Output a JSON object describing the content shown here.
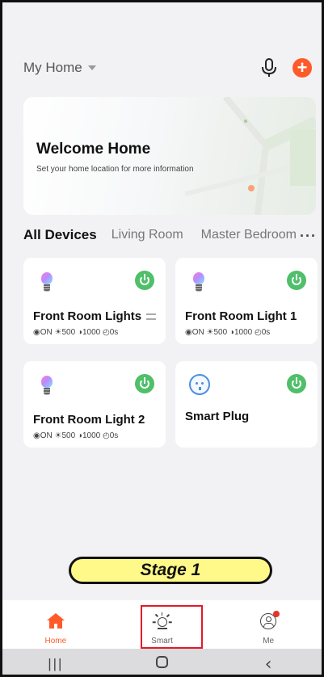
{
  "header": {
    "home_name": "My Home",
    "caret_icon": "caret-down-icon",
    "mic_icon": "microphone-icon",
    "add_icon": "plus-circle-icon"
  },
  "welcome": {
    "title": "Welcome Home",
    "subtitle": "Set your home location for more information"
  },
  "room_tabs": [
    {
      "label": "All Devices",
      "active": true
    },
    {
      "label": "Living Room",
      "active": false
    },
    {
      "label": "Master Bedroom",
      "active": false
    }
  ],
  "more_icon": "···",
  "devices": [
    {
      "name": "Front Room Lights",
      "info": "◉ON ☀500 ◑1000 ◴0s",
      "type": "bulb",
      "group": true
    },
    {
      "name": "Front Room Light 1",
      "info": "◉ON ☀500 ◑1000 ◴0s",
      "type": "bulb"
    },
    {
      "name": "Front Room Light 2",
      "info": "◉ON ☀500 ◑1000 ◴0s",
      "type": "bulb"
    },
    {
      "name": "Smart Plug",
      "info": "",
      "type": "plug"
    }
  ],
  "stage_label": "Stage 1",
  "tabbar": [
    {
      "label": "Home",
      "icon": "home-icon",
      "active": true
    },
    {
      "label": "Smart",
      "icon": "sun-icon",
      "active": false
    },
    {
      "label": "Me",
      "icon": "user-icon",
      "active": false
    }
  ],
  "nav": {
    "recent": "|||",
    "back": "‹"
  },
  "colors": {
    "accent": "#ff5a2a",
    "power_on": "#4fbf6a",
    "highlight": "#e5182a"
  }
}
